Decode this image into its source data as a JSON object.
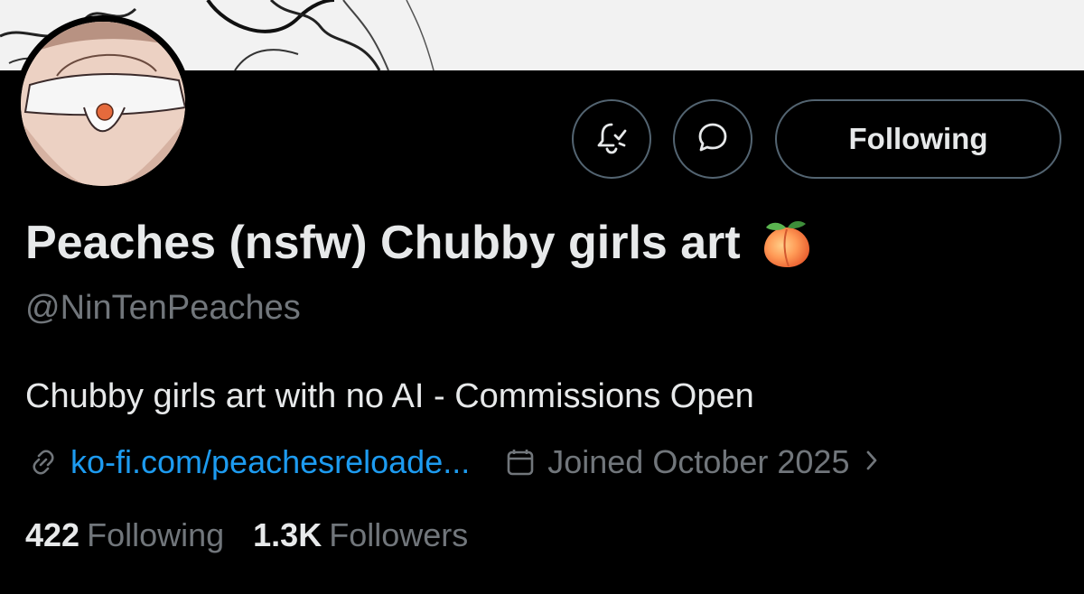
{
  "profile": {
    "display_name": "Peaches (nsfw) Chubby girls art",
    "handle": "@NinTenPeaches",
    "bio": "Chubby girls art with no AI - Commissions Open",
    "website": "ko-fi.com/peachesreloade...",
    "joined": "Joined October 2025",
    "emoji_icon": "peach-emoji"
  },
  "actions": {
    "notify_icon": "bell-check-icon",
    "message_icon": "message-icon",
    "follow_label": "Following"
  },
  "stats": {
    "following_count": "422",
    "following_label": "Following",
    "followers_count": "1.3K",
    "followers_label": "Followers"
  },
  "colors": {
    "background": "#000000",
    "text_primary": "#e7e9ea",
    "text_secondary": "#71767b",
    "link": "#1d9bf0",
    "border": "#536471"
  }
}
